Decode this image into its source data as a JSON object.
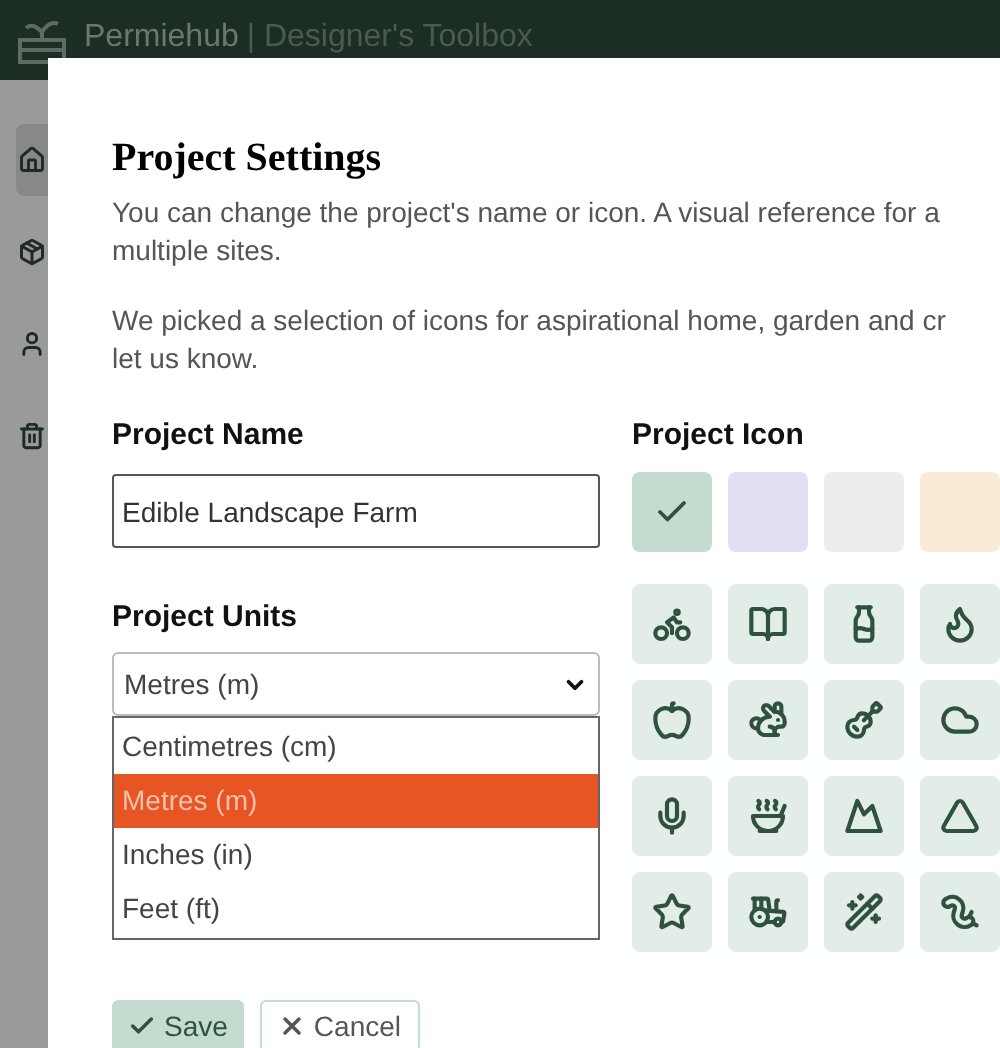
{
  "header": {
    "brand": "Permiehub",
    "subtitle": "| Designer's Toolbox"
  },
  "sidebar": {
    "items": [
      {
        "selected": true
      },
      {
        "selected": false
      },
      {
        "selected": false
      },
      {
        "selected": false
      }
    ]
  },
  "dialog": {
    "title": "Project Settings",
    "paragraphs": [
      [
        "You can change the project's name or icon. A visual reference for a",
        "multiple sites."
      ],
      [
        "We picked a selection of icons for aspirational home, garden and cr",
        "let us know."
      ]
    ],
    "name_field": {
      "label": "Project Name",
      "value": "Edible Landscape Farm"
    },
    "units_field": {
      "label": "Project Units",
      "value": "Metres (m)",
      "expanded": true,
      "options": [
        {
          "label": "Centimetres (cm)",
          "selected": false
        },
        {
          "label": "Metres (m)",
          "selected": true
        },
        {
          "label": "Inches (in)",
          "selected": false
        },
        {
          "label": "Feet (ft)",
          "selected": false
        }
      ]
    },
    "icon_picker": {
      "label": "Project Icon",
      "swatches": [
        {
          "color": "#c3dccf",
          "selected": true
        },
        {
          "color": "#e2def2",
          "selected": false
        },
        {
          "color": "#ececec",
          "selected": false
        },
        {
          "color": "#f9ead6",
          "selected": false
        }
      ]
    },
    "buttons": [
      {
        "label": "Save",
        "kind": "primary"
      },
      {
        "label": "Cancel",
        "kind": "secondary"
      }
    ]
  }
}
